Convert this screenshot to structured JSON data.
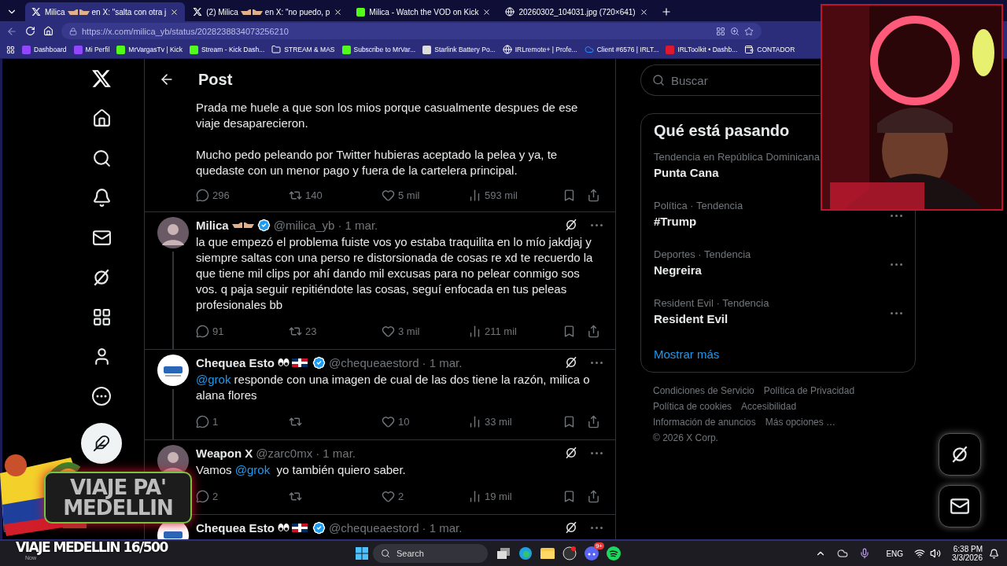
{
  "browser": {
    "tabs": [
      {
        "title": "Milica",
        "title_end": "en X: \"salta con otra j",
        "selected": true
      },
      {
        "title": "(2) Milica",
        "title_end": "en X: \"no puedo, p",
        "selected": false
      },
      {
        "title": "Milica - Watch the VOD on Kick",
        "selected": false
      },
      {
        "title": "20260302_104031.jpg (720×641)",
        "selected": false
      }
    ],
    "address": "https://x.com/milica_yb/status/2028238834073256210",
    "bookmarks": [
      "Dashboard",
      "Mi Perfil",
      "MrVargasTv | Kick",
      "Stream - Kick Dash...",
      "STREAM & MAS",
      "Subscribe to MrVar...",
      "Starlink Battery Po...",
      "IRLremote+ | Profe...",
      "Client #6576 | IRLT...",
      "IRLToolkit • Dashb...",
      "CONTADOR"
    ]
  },
  "header": {
    "title": "Post"
  },
  "main_post": {
    "paragraphs": [
      "Prada me huele a que son los mios porque casualmente despues de ese viaje desaparecieron.",
      "Mucho pedo peleando por Twitter hubieras aceptado la pelea y ya, te quedaste con un menor pago y fuera de la cartelera principal."
    ],
    "stats": {
      "replies": "296",
      "reposts": "140",
      "likes": "5 mil",
      "views": "593 mil"
    }
  },
  "replies": [
    {
      "name": "Milica",
      "verified": true,
      "handle": "@milica_yb",
      "date": "· 1 mar.",
      "segments": [
        {
          "kind": "text",
          "text": "la que empezó el problema fuiste vos yo estaba traquilita en lo mío jakdjaj y siempre saltas con una perso re distorsionada de cosas re xd te recuerdo la que tiene mil clips por ahí dando mil excusas para no pelear conmigo sos vos. q paja seguir repitiéndote las cosas, seguí enfocada en tus peleas profesionales bb"
        }
      ],
      "stats": {
        "replies": "91",
        "reposts": "23",
        "likes": "3 mil",
        "views": "211 mil"
      }
    },
    {
      "name": "Chequea Esto",
      "verified": true,
      "handle": "@chequeaestord",
      "date": "· 1 mar.",
      "segments": [
        {
          "kind": "mention",
          "text": "@grok"
        },
        {
          "kind": "text",
          "text": " responde con una imagen de cual de las dos tiene la razón, milica o alana flores"
        }
      ],
      "stats": {
        "replies": "1",
        "likes": "10",
        "views": "33 mil"
      }
    },
    {
      "name": "Weapon X",
      "verified": false,
      "handle": "@zarc0mx",
      "date": "· 1 mar.",
      "segments": [
        {
          "kind": "text",
          "text": "Vamos "
        },
        {
          "kind": "mention",
          "text": "@grok"
        },
        {
          "kind": "text",
          "text": "  yo también quiero saber."
        }
      ],
      "stats": {
        "replies": "2",
        "likes": "2",
        "views": "19 mil"
      }
    },
    {
      "name": "Chequea Esto",
      "verified": true,
      "handle": "@chequeaestord",
      "date": "· 1 mar."
    }
  ],
  "search": {
    "placeholder": "Buscar"
  },
  "trends": {
    "title": "Qué está pasando",
    "items": [
      {
        "context": "Tendencia en República Dominicana",
        "name": "Punta Cana"
      },
      {
        "context": "Política · Tendencia",
        "name": "#Trump"
      },
      {
        "context": "Deportes · Tendencia",
        "name": "Negreira"
      },
      {
        "context": "Resident Evil · Tendencia",
        "name": "Resident Evil"
      }
    ],
    "more": "Mostrar más"
  },
  "footer": [
    "Condiciones de Servicio",
    "Política de Privacidad",
    "Política de cookies",
    "Accesibilidad",
    "Información de anuncios",
    "Más opciones …",
    "© 2026 X Corp."
  ],
  "overlay": {
    "banner": [
      "VIAJE PA'",
      "MEDELLIN"
    ],
    "caption": "VIAJE MEDELLIN 16/500"
  },
  "taskbar": {
    "notification": "Now",
    "search": "Search",
    "discord_badge": "9+",
    "language": "ENG",
    "time": "6:38 PM",
    "date": "3/3/2026"
  }
}
